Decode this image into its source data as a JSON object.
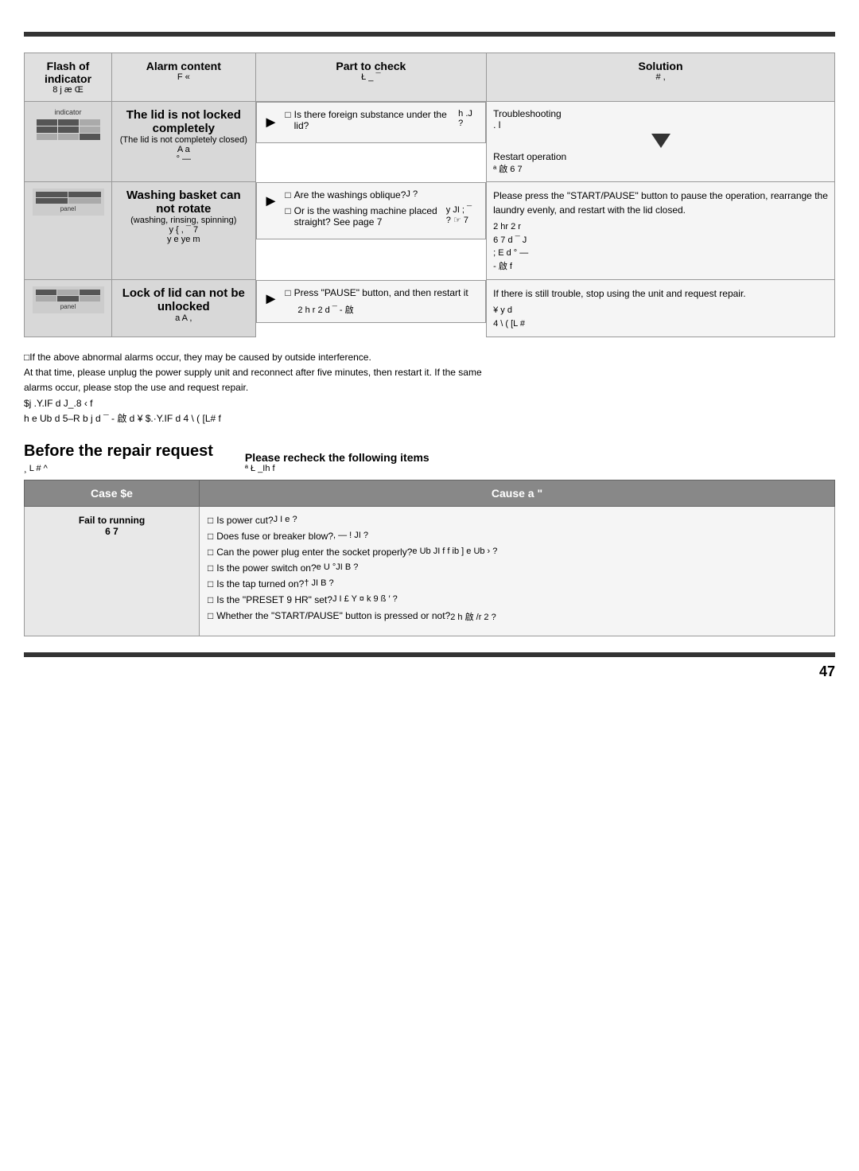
{
  "topBar": {},
  "header": {
    "col1": {
      "label": "Flash of indicator",
      "sub": "8 j æ Œ"
    },
    "col2": {
      "label": "Alarm content",
      "sub": "F  «"
    },
    "col3": {
      "label": "Part to check",
      "sub": "Ł _ ¯"
    },
    "col4": {
      "label": "Solution",
      "sub": "#  ,"
    }
  },
  "rows": [
    {
      "id": "row1",
      "indicator": "grid",
      "alarm": {
        "main": "The lid is not locked completely",
        "sub": "(The lid is not completely closed)",
        "korean": "A a\n° —"
      },
      "parts": [
        "Is there foreign substance under the lid?",
        "h  .J    ?"
      ],
      "solution": {
        "main": "Troubleshooting\n. l",
        "triangle": true,
        "sub": "Restart operation",
        "korean": "ª 啟  6 7"
      }
    },
    {
      "id": "row2",
      "indicator": "panel",
      "alarm": {
        "main": "Washing basket can not rotate",
        "sub": "(washing, rinsing, spinning)",
        "korean": "y {  , ¯ 7\ny  e  ye m"
      },
      "parts": [
        "Are the washings oblique?\nJ       ?",
        "Or is the washing machine placed straight? See page 7\ny  JI ;  ¯       ? ☞ 7"
      ],
      "solution": {
        "main": "Please press the \"START/PAUSE\" button to pause the operation, rearrange the laundry evenly, and restart with the lid closed.",
        "korean": "2 hr  2  r\n6 7 d  ¯  J\n; E  d ° —\n -  啟  f"
      }
    },
    {
      "id": "row3",
      "indicator": "panel2",
      "alarm": {
        "main": "Lock of lid can not be unlocked",
        "korean": "a A   ,"
      },
      "parts": [
        "Press \"PAUSE\" button, and then restart it",
        "2 h r  2 d ¯  -       啟"
      ],
      "solution": {
        "main": "If there is still trouble, stop using the unit and request repair.",
        "korean": "¥  y d\n4 \\ (  [L #"
      }
    }
  ],
  "note": {
    "line1": "□If the above abnormal alarms occur, they may be caused by outside interference.",
    "line2": "  At that time, please unplug the power supply unit and reconnect after five minutes, then restart it. If the same",
    "line3": "  alarms occur, please stop the use and request repair.",
    "line4": "  $j  .Y.IF d   J_.8   ‹ f",
    "line5": "  h e Ub d     5–R   b j d ¯  -       啟  d ¥ $.·Y.IF d    4 \\ (  [L# f"
  },
  "repair": {
    "title": "Before the repair request",
    "titleKorean": "¸ L # ^",
    "desc": "Please recheck the following items",
    "descKorean": "ª Ł _Ih f",
    "table": {
      "col1Header": "Case   $e",
      "col2Header": "Cause   a \"",
      "rows": [
        {
          "case": "Fail to running\n6 7",
          "causes": [
            "Is power cut?\nJ I  e   ?",
            "Does fuse or breaker blow?\n,   — !  JI           ?",
            "Can the power plug enter the socket properly?\ne Ub  JI  f f ib ] e Ub ›        ?",
            "Is the power switch on?\ne U  °JI B       ?",
            "Is the tap turned on?\n†  JI B      ?",
            "Is the \"PRESET 9 HR\" set?\nJ I £  Y ¤ k    9    ß ′    ?",
            "Whether the \"START/PAUSE\" button is pressed or not?\n2 h    啟  /r  2      ?"
          ]
        }
      ]
    }
  },
  "pageNumber": "47"
}
